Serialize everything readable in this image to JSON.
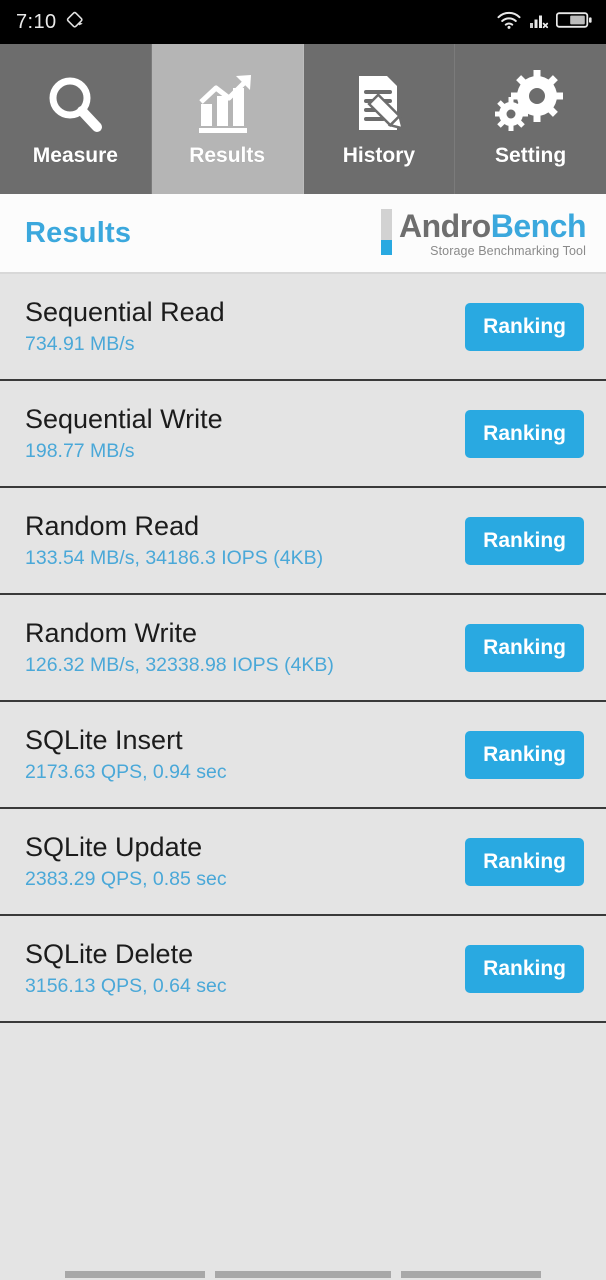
{
  "status_bar": {
    "time": "7:10",
    "left_icon": "rhombus-icon",
    "icons": [
      "wifi-icon",
      "signal-no-sim-icon",
      "battery-icon"
    ],
    "battery_level_percent": 62
  },
  "tabs": [
    {
      "label": "Measure",
      "icon": "magnifier-icon",
      "active": false
    },
    {
      "label": "Results",
      "icon": "bar-chart-arrow-icon",
      "active": true
    },
    {
      "label": "History",
      "icon": "document-pencil-icon",
      "active": false
    },
    {
      "label": "Setting",
      "icon": "gears-icon",
      "active": false
    }
  ],
  "header": {
    "title": "Results",
    "logo": {
      "primary": "Andro",
      "secondary": "Bench",
      "tagline": "Storage Benchmarking Tool"
    }
  },
  "results": [
    {
      "name": "Sequential Read",
      "value": "734.91 MB/s",
      "button": "Ranking"
    },
    {
      "name": "Sequential Write",
      "value": "198.77 MB/s",
      "button": "Ranking"
    },
    {
      "name": "Random Read",
      "value": "133.54 MB/s, 34186.3 IOPS (4KB)",
      "button": "Ranking"
    },
    {
      "name": "Random Write",
      "value": "126.32 MB/s, 32338.98 IOPS (4KB)",
      "button": "Ranking"
    },
    {
      "name": "SQLite Insert",
      "value": "2173.63 QPS, 0.94 sec",
      "button": "Ranking"
    },
    {
      "name": "SQLite Update",
      "value": "2383.29 QPS, 0.85 sec",
      "button": "Ranking"
    },
    {
      "name": "SQLite Delete",
      "value": "3156.13 QPS, 0.64 sec",
      "button": "Ranking"
    }
  ],
  "nav_bar": {
    "back": "back-button",
    "home": "home-button",
    "recents": "recents-button"
  },
  "colors": {
    "accent_blue": "#29a9e1",
    "title_blue": "#3ba8dd",
    "value_blue": "#4aa8d8",
    "tab_inactive": "#6d6d6d",
    "tab_active": "#b5b5b5",
    "row_background": "#e4e4e4",
    "row_divider": "#3a3a3a",
    "header_background": "#fcfcfc",
    "status_bar_background": "#000000"
  }
}
